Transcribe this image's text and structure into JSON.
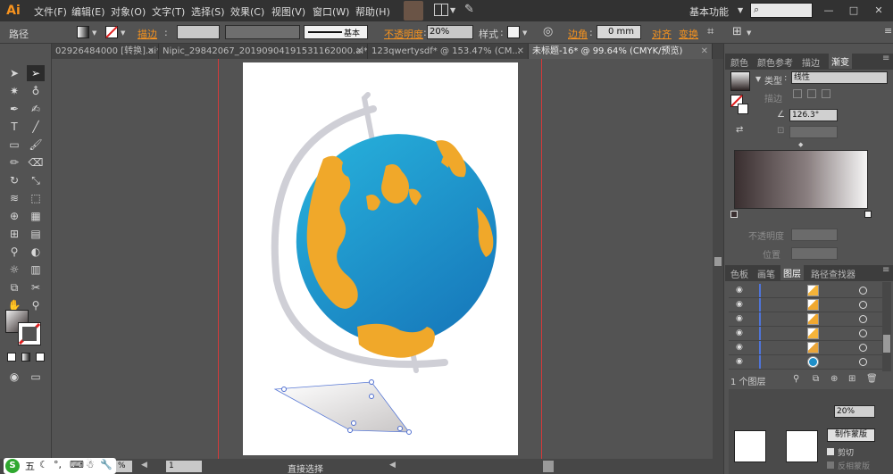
{
  "app": {
    "logo": "Ai",
    "workspace": "基本功能"
  },
  "menu": {
    "items": [
      "文件(F)",
      "编辑(E)",
      "对象(O)",
      "文字(T)",
      "选择(S)",
      "效果(C)",
      "视图(V)",
      "窗口(W)",
      "帮助(H)"
    ]
  },
  "window_controls": {
    "minimize": "—",
    "maximize": "□",
    "close": "✕"
  },
  "control_bar": {
    "selection_type": "路径",
    "stroke_label": "描边",
    "brush_label": "基本",
    "opacity_label": "不透明度",
    "opacity_value": "20%",
    "style_label": "样式",
    "corner_label": "边角",
    "corner_value": "0 mm",
    "align_label": "对齐",
    "transform_label": "变换"
  },
  "document_tabs": [
    {
      "label": "02926484000 [转换].ai*",
      "active": false
    },
    {
      "label": "Nipic_29842067_20190904191531162000.ai*",
      "active": false
    },
    {
      "label": "123qwertysdf* @ 153.47% (CM...",
      "active": false
    },
    {
      "label": "未标题-16* @ 99.64% (CMYK/预览)",
      "active": true
    }
  ],
  "status_bar": {
    "zoom": "%",
    "page": "1",
    "tool_status": "直接选择"
  },
  "ime": {
    "logo": "S",
    "mode": "五"
  },
  "gradient_panel": {
    "tabs": [
      "颜色",
      "颜色参考",
      "描边",
      "渐变"
    ],
    "active_tab": "渐变",
    "type_label": "类型",
    "type_value": "线性",
    "stroke_label": "描边",
    "angle_value": "126.3°",
    "opacity_label": "不透明度",
    "position_label": "位置",
    "colors": {
      "start": "#3a2f30",
      "end": "#f5f5f5"
    }
  },
  "layers_panel": {
    "tabs": [
      "色板",
      "画笔",
      "图层",
      "路径查找器"
    ],
    "active_tab": "图层",
    "rows": [
      {
        "thumb_color": "#f5b43a"
      },
      {
        "thumb_color": "#f0a830"
      },
      {
        "thumb_color": "#f0a830"
      },
      {
        "thumb_color": "#f5b43a"
      },
      {
        "thumb_color": "#e9a53a"
      },
      {
        "thumb_color": "#1f8fc9"
      }
    ],
    "footer": "1 个图层"
  },
  "lower_panel": {
    "opacity_value": "20%",
    "clip_button": "制作蒙版",
    "clip_checkbox": "剪切",
    "invert_checkbox": "反相蒙版"
  },
  "artwork": {
    "ocean_start": "#28b4dd",
    "ocean_end": "#1573b8",
    "land_color": "#f0a82a",
    "stand_color": "#cfcfd6"
  }
}
